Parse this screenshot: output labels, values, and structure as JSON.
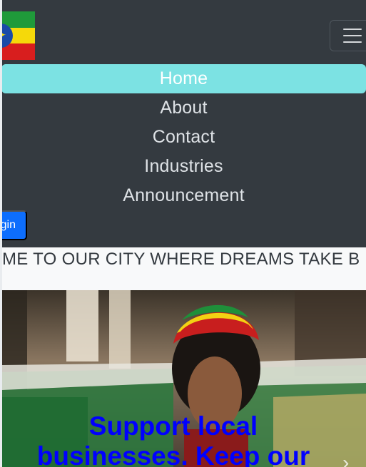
{
  "nav": {
    "items": [
      {
        "label": "Home",
        "active": true
      },
      {
        "label": "About",
        "active": false
      },
      {
        "label": "Contact",
        "active": false
      },
      {
        "label": "Industries",
        "active": false
      },
      {
        "label": "Announcement",
        "active": false
      }
    ],
    "login_label": "Login",
    "login_visible": "gin",
    "active_color": "#7ce2e3",
    "background_color": "#343a40"
  },
  "flag": {
    "icon": "ethiopian-flag-icon",
    "colors": [
      "#1f9a3a",
      "#f5d90a",
      "#d81e1e",
      "#1a4aa8"
    ]
  },
  "toggler": {
    "icon": "hamburger-menu-icon"
  },
  "marquee": {
    "text": "ME TO OUR CITY WHERE DREAMS TAKE B"
  },
  "hero": {
    "text": "Support local businesses. Keep our",
    "text_color": "#0000ff"
  },
  "carousel": {
    "next_icon": "chevron-right-icon"
  }
}
